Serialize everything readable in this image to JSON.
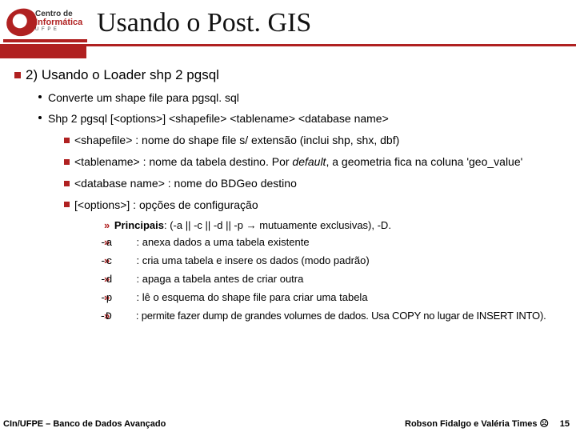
{
  "logo": {
    "line1": "Centro de",
    "line2": "Informática",
    "line3": "U F P E"
  },
  "title": "Usando o Post. GIS",
  "h1": "2) Usando o Loader  shp 2 pgsql",
  "b1": "Converte um  shape file  para  pgsql. sql",
  "b2": "Shp 2 pgsql [<options>] <shapefile> <tablename> <database name>",
  "s1": "<shapefile> :  nome do shape file s/ extensão (inclui shp, shx, dbf)",
  "s2a": "<tablename> :  nome da tabela destino. Por ",
  "s2b": "default",
  "s2c": ", a geometria fica na coluna 'geo_value'",
  "s3": "<database name> :  nome do BDGeo destino",
  "s4": "[<options>] :   opções de configuração",
  "p_label": "Principais",
  "p_rest": ": (-a || -c || -d || -p → mutuamente exclusivas), -D.",
  "opts": [
    {
      "flag": "-a",
      "desc": ": anexa dados a uma tabela existente"
    },
    {
      "flag": "-c",
      "desc": ": cria uma tabela e insere os dados (modo padrão)"
    },
    {
      "flag": "-d",
      "desc": ": apaga a tabela antes de criar outra"
    },
    {
      "flag": "-p",
      "desc": ": lê o esquema do shape file para criar uma tabela"
    },
    {
      "flag": "-D",
      "desc": ": permite fazer dump de  grandes volumes de dados. Usa COPY no lugar de INSERT INTO)."
    }
  ],
  "footer_left": "CIn/UFPE – Banco de Dados Avançado",
  "footer_right": "Robson Fidalgo e Valéria Times ☹",
  "page": "15"
}
